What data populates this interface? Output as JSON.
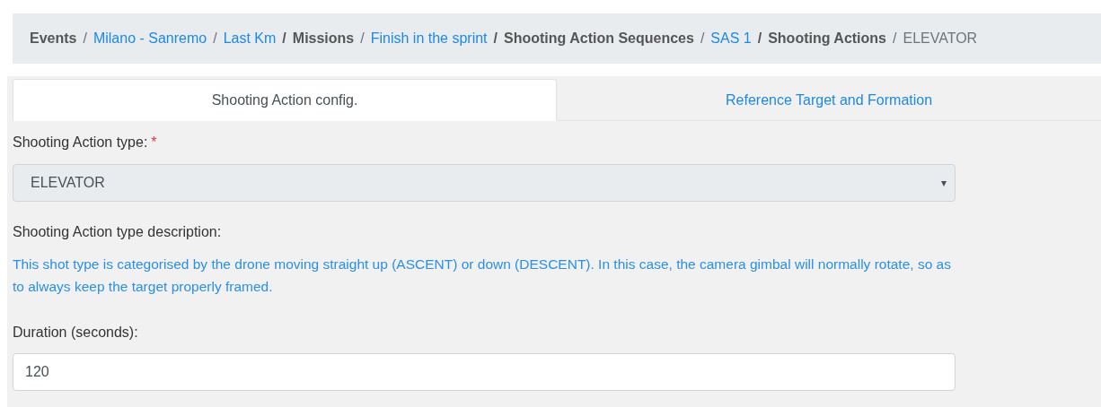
{
  "breadcrumb": [
    {
      "label": "Events",
      "kind": "section"
    },
    {
      "label": "Milano - Sanremo",
      "kind": "link",
      "separator": "/"
    },
    {
      "label": "Last Km",
      "kind": "link",
      "separator": "/"
    },
    {
      "label": "Missions",
      "kind": "section",
      "separator": "/"
    },
    {
      "label": "Finish in the sprint",
      "kind": "link",
      "separator": "/"
    },
    {
      "label": "Shooting Action Sequences",
      "kind": "section",
      "separator": "/"
    },
    {
      "label": "SAS 1",
      "kind": "link",
      "separator": "/"
    },
    {
      "label": "Shooting Actions",
      "kind": "section",
      "separator": "/"
    },
    {
      "label": "ELEVATOR",
      "kind": "current",
      "separator": "/"
    }
  ],
  "tabs": [
    {
      "label": "Shooting Action config.",
      "selected": true
    },
    {
      "label": "Reference Target and Formation",
      "selected": false
    }
  ],
  "type_field": {
    "label": "Shooting Action type:",
    "required_mark": "*",
    "value": "ELEVATOR",
    "caret": "▾",
    "disabled": true
  },
  "description": {
    "label": "Shooting Action type description:",
    "text": "This shot type is categorised by the drone moving straight up (ASCENT) or down (DESCENT). In this case, the camera gimbal will normally rotate, so as to always keep the target properly framed."
  },
  "duration_field": {
    "label": "Duration (seconds):",
    "value": "120"
  }
}
